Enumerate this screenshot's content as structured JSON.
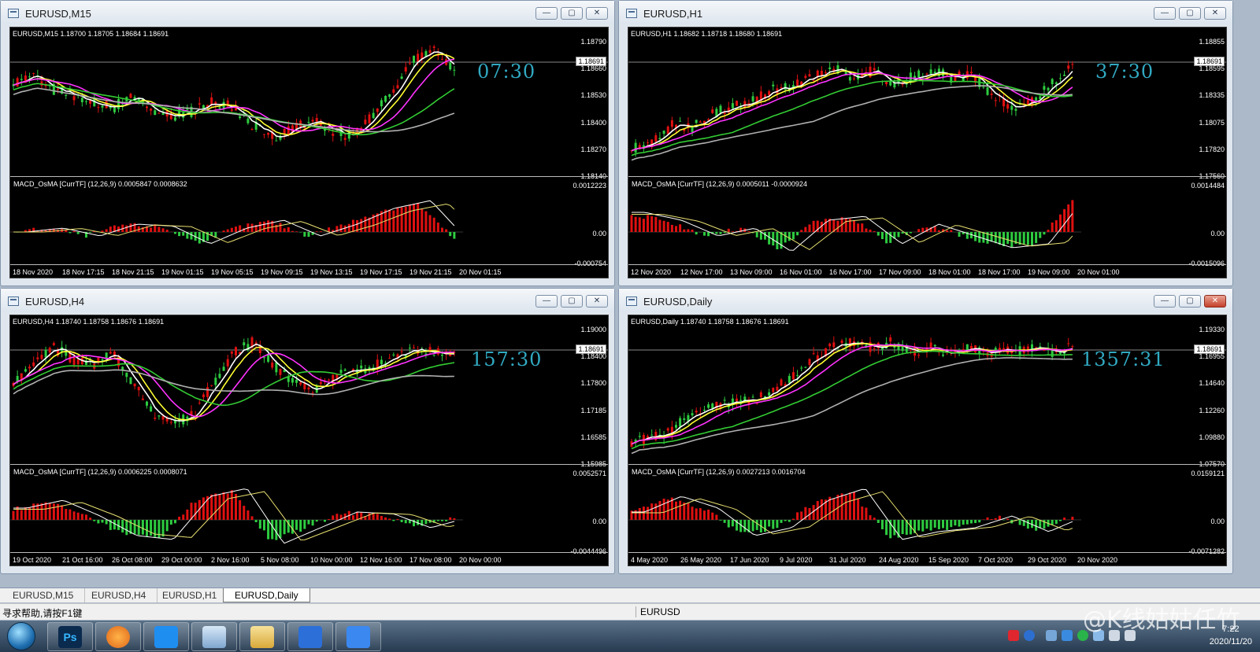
{
  "windows": {
    "m15": {
      "title": "EURUSD,M15",
      "header": "EURUSD,M15  1.18700 1.18705 1.18684 1.18691",
      "bid": "1.18691",
      "timer": "07:30",
      "price_ticks": [
        "1.18790",
        "1.18660",
        "1.18530",
        "1.18400",
        "1.18270",
        "1.18140"
      ],
      "macd_header": "MACD_OsMA [CurrTF] (12,26,9) 0.0005847 0.0008632",
      "macd_ticks": [
        "0.0012223",
        "0.00",
        "-0.000754"
      ],
      "x_ticks": [
        "18 Nov 2020",
        "18 Nov 17:15",
        "18 Nov 21:15",
        "19 Nov 01:15",
        "19 Nov 05:15",
        "19 Nov 09:15",
        "19 Nov 13:15",
        "19 Nov 17:15",
        "19 Nov 21:15",
        "20 Nov 01:15"
      ]
    },
    "h1": {
      "title": "EURUSD,H1",
      "header": "EURUSD,H1  1.18682 1.18718 1.18680 1.18691",
      "bid": "1.18691",
      "timer": "37:30",
      "price_ticks": [
        "1.18855",
        "1.18595",
        "1.18335",
        "1.18075",
        "1.17820",
        "1.17560"
      ],
      "macd_header": "MACD_OsMA [CurrTF] (12,26,9) 0.0005011 -0.0000924",
      "macd_ticks": [
        "0.0014484",
        "0.00",
        "-0.0015096"
      ],
      "x_ticks": [
        "12 Nov 2020",
        "12 Nov 17:00",
        "13 Nov 09:00",
        "16 Nov 01:00",
        "16 Nov 17:00",
        "17 Nov 09:00",
        "18 Nov 01:00",
        "18 Nov 17:00",
        "19 Nov 09:00",
        "20 Nov 01:00"
      ]
    },
    "h4": {
      "title": "EURUSD,H4",
      "header": "EURUSD,H4  1.18740 1.18758 1.18676 1.18691",
      "bid": "1.18691",
      "timer": "157:30",
      "price_ticks": [
        "1.19000",
        "1.18400",
        "1.17800",
        "1.17185",
        "1.16585",
        "1.15985"
      ],
      "macd_header": "MACD_OsMA [CurrTF] (12,26,9) 0.0006225 0.0008071",
      "macd_ticks": [
        "0.0052571",
        "0.00",
        "-0.0044496"
      ],
      "x_ticks": [
        "19 Oct 2020",
        "21 Oct 16:00",
        "26 Oct 08:00",
        "29 Oct 00:00",
        "2 Nov 16:00",
        "5 Nov 08:00",
        "10 Nov 00:00",
        "12 Nov 16:00",
        "17 Nov 08:00",
        "20 Nov 00:00"
      ]
    },
    "daily": {
      "title": "EURUSD,Daily",
      "header": "EURUSD,Daily  1.18740 1.18758 1.18676 1.18691",
      "bid": "1.18691",
      "timer": "1357:31",
      "price_ticks": [
        "1.19330",
        "1.16955",
        "1.14640",
        "1.12260",
        "1.09880",
        "1.07570"
      ],
      "macd_header": "MACD_OsMA [CurrTF] (12,26,9) 0.0027213 0.0016704",
      "macd_ticks": [
        "0.0159121",
        "0.00",
        "-0.0071282"
      ],
      "x_ticks": [
        "4 May 2020",
        "26 May 2020",
        "17 Jun 2020",
        "9 Jul 2020",
        "31 Jul 2020",
        "24 Aug 2020",
        "15 Sep 2020",
        "7 Oct 2020",
        "29 Oct 2020",
        "20 Nov 2020"
      ]
    }
  },
  "window_buttons": {
    "minimize": "—",
    "restore": "▢",
    "close": "✕"
  },
  "tabs": [
    "EURUSD,M15",
    "EURUSD,H4",
    "EURUSD,H1",
    "EURUSD,Daily"
  ],
  "active_tab": "EURUSD,Daily",
  "status": {
    "help": "寻求帮助,请按F1键",
    "symbol": "EURUSD"
  },
  "taskbar": {
    "apps": [
      "Ps",
      "Foxmail",
      "Lanhu",
      "Remote Desktop",
      "File Explorer",
      "WPS",
      "Notes"
    ],
    "clock_time": "7:22",
    "clock_date": "2020/11/20",
    "watermark": "@K线姑姑任竹"
  },
  "colors": {
    "bull": "#2ecc40",
    "bear": "#e01010",
    "ma_white": "#ffffff",
    "ma_yellow": "#ffff33",
    "ma_magenta": "#ff33ff",
    "ma_green": "#33cc33",
    "ma_gray": "#b0b0b0",
    "timer": "#31a9c2"
  },
  "icons": [
    "window-icon",
    "minimize-icon",
    "restore-icon",
    "close-icon",
    "start-orb-icon",
    "network-icon",
    "volume-icon"
  ]
}
